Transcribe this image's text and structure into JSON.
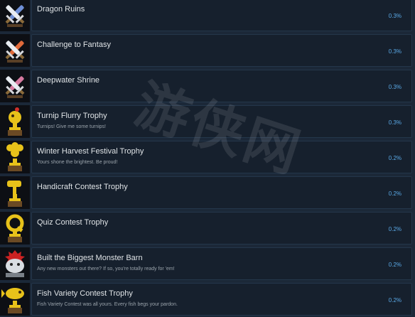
{
  "achievements": [
    {
      "title": "Dragon Ruins",
      "description": "",
      "percent": "0.3%",
      "icon": "crossed-swords-icon",
      "accent": "#6f8fd6"
    },
    {
      "title": "Challenge to Fantasy",
      "description": "",
      "percent": "0.3%",
      "icon": "crossed-swords-icon",
      "accent": "#e06a3a"
    },
    {
      "title": "Deepwater Shrine",
      "description": "",
      "percent": "0.3%",
      "icon": "crossed-swords-icon",
      "accent": "#d77aa0"
    },
    {
      "title": "Turnip Flurry Trophy",
      "description": "Turnips! Give me some turnips!",
      "percent": "0.3%",
      "icon": "turnip-trophy-icon",
      "accent": "#e8c21a"
    },
    {
      "title": "Winter Harvest Festival Trophy",
      "description": "Yours shone the brightest. Be proud!",
      "percent": "0.2%",
      "icon": "bouquet-trophy-icon",
      "accent": "#e8c21a"
    },
    {
      "title": "Handicraft Contest Trophy",
      "description": "",
      "percent": "0.2%",
      "icon": "hammer-trophy-icon",
      "accent": "#e8c21a"
    },
    {
      "title": "Quiz Contest Trophy",
      "description": "",
      "percent": "0.2%",
      "icon": "q-trophy-icon",
      "accent": "#e8c21a"
    },
    {
      "title": "Built the Biggest Monster Barn",
      "description": "Any new monsters out there? If so, you're totally ready for 'em!",
      "percent": "0.2%",
      "icon": "monster-barn-icon",
      "accent": "#d9dde2"
    },
    {
      "title": "Fish Variety Contest Trophy",
      "description": "Fish Variety Contest was all yours. Every fish begs your pardon.",
      "percent": "0.2%",
      "icon": "fish-trophy-icon",
      "accent": "#e8c21a"
    }
  ]
}
